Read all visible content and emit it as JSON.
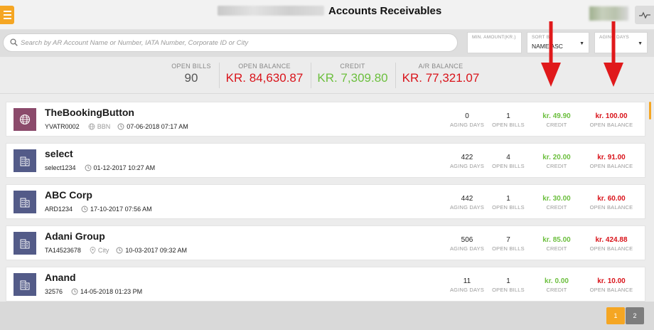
{
  "header": {
    "title": "Accounts Receivables"
  },
  "search": {
    "placeholder": "Search by AR Account Name or Number, IATA Number, Corporate ID or City"
  },
  "filters": {
    "min_amount_label": "MIN. AMOUNT(KR.)",
    "min_amount_value": "",
    "sort_label": "SORT BY",
    "sort_value": "NAME ASC",
    "aging_label": "AGING DAYS",
    "aging_value": ""
  },
  "summary": {
    "open_bills_label": "OPEN BILLS",
    "open_bills_value": "90",
    "open_balance_label": "OPEN BALANCE",
    "open_balance_value": "KR. 84,630.87",
    "credit_label": "CREDIT",
    "credit_value": "KR. 7,309.80",
    "ar_balance_label": "A/R BALANCE",
    "ar_balance_value": "KR. 77,321.07"
  },
  "colors": {
    "accent": "#f5a623",
    "credit": "#6cbf3e",
    "balance": "#d9141b",
    "avatar_globe": "#8b4a6b",
    "avatar_building": "#535b88",
    "annotation_arrow": "#e0191b"
  },
  "column_labels": {
    "aging": "AGING DAYS",
    "bills": "OPEN BILLS",
    "credit": "CREDIT",
    "balance": "OPEN BALANCE"
  },
  "accounts": [
    {
      "name": "TheBookingButton",
      "id": "YVATR0002",
      "iata": "BBN",
      "city": "",
      "date": "07-06-2018 07:17 AM",
      "icon": "globe-icon",
      "aging": "0",
      "bills": "1",
      "credit": "kr. 49.90",
      "balance": "kr. 100.00"
    },
    {
      "name": "select",
      "id": "select1234",
      "iata": "",
      "city": "",
      "date": "01-12-2017 10:27 AM",
      "icon": "building-icon",
      "aging": "422",
      "bills": "4",
      "credit": "kr. 20.00",
      "balance": "kr. 91.00"
    },
    {
      "name": "ABC Corp",
      "id": "ARD1234",
      "iata": "",
      "city": "",
      "date": "17-10-2017 07:56 AM",
      "icon": "building-icon",
      "aging": "442",
      "bills": "1",
      "credit": "kr. 30.00",
      "balance": "kr. 60.00"
    },
    {
      "name": "Adani Group",
      "id": "TA14523678",
      "iata": "",
      "city": "City",
      "date": "10-03-2017 09:32 AM",
      "icon": "building-icon",
      "aging": "506",
      "bills": "7",
      "credit": "kr. 85.00",
      "balance": "kr. 424.88"
    },
    {
      "name": "Anand",
      "id": "32576",
      "iata": "",
      "city": "",
      "date": "14-05-2018 01:23 PM",
      "icon": "building-icon",
      "aging": "11",
      "bills": "1",
      "credit": "kr. 0.00",
      "balance": "kr. 10.00"
    }
  ],
  "pagination": {
    "pages": [
      "1",
      "2"
    ],
    "current": "1"
  }
}
